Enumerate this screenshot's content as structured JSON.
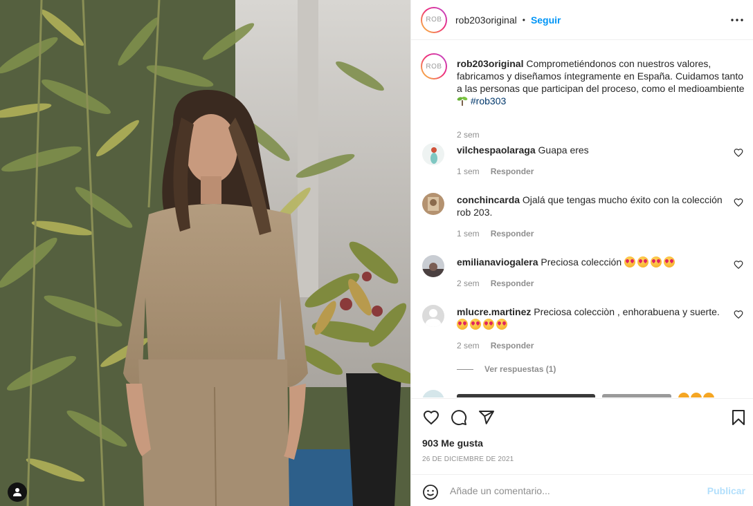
{
  "post": {
    "account": {
      "username": "rob203original",
      "avatar_text": "ROB",
      "follow_label": "Seguir",
      "separator": "•"
    },
    "caption": {
      "username": "rob203original",
      "text": "Comprometiéndonos con nuestros valores, fabricamos y diseñamos íntegramente en España. Cuidamos tanto a las personas que participan del proceso, como el medioambiente",
      "hashtag": "#rob303",
      "time": "2 sem"
    },
    "comments": [
      {
        "username": "vilchespaolaraga",
        "text": "Guapa eres",
        "time": "1 sem",
        "reply_label": "Responder",
        "emojis": 0
      },
      {
        "username": "conchincarda",
        "text": "Ojalá que tengas mucho éxito con la colección rob 203.",
        "time": "1 sem",
        "reply_label": "Responder",
        "emojis": 0
      },
      {
        "username": "emilianaviogalera",
        "text": "Preciosa colección",
        "time": "2 sem",
        "reply_label": "Responder",
        "emojis": 4
      },
      {
        "username": "mlucre.martinez",
        "text": "Preciosa colecciòn , enhorabuena y suerte.",
        "time": "2 sem",
        "reply_label": "Responder",
        "emojis": 4
      }
    ],
    "view_replies_label": "Ver respuestas (1)",
    "likes": "903 Me gusta",
    "date": "26 DE DICIEMBRE DE 2021",
    "add_comment": {
      "placeholder": "Añade un comentario...",
      "publish_label": "Publicar"
    }
  },
  "colors": {
    "follow": "#0095f6",
    "hashtag": "#00376b",
    "muted": "#8e8e8e",
    "publish_disabled": "#b2dffc"
  },
  "icons": [
    "more-options-icon",
    "heart-icon",
    "comment-icon",
    "share-icon",
    "bookmark-icon",
    "emoji-icon",
    "user-tag-icon",
    "sprout-icon"
  ]
}
